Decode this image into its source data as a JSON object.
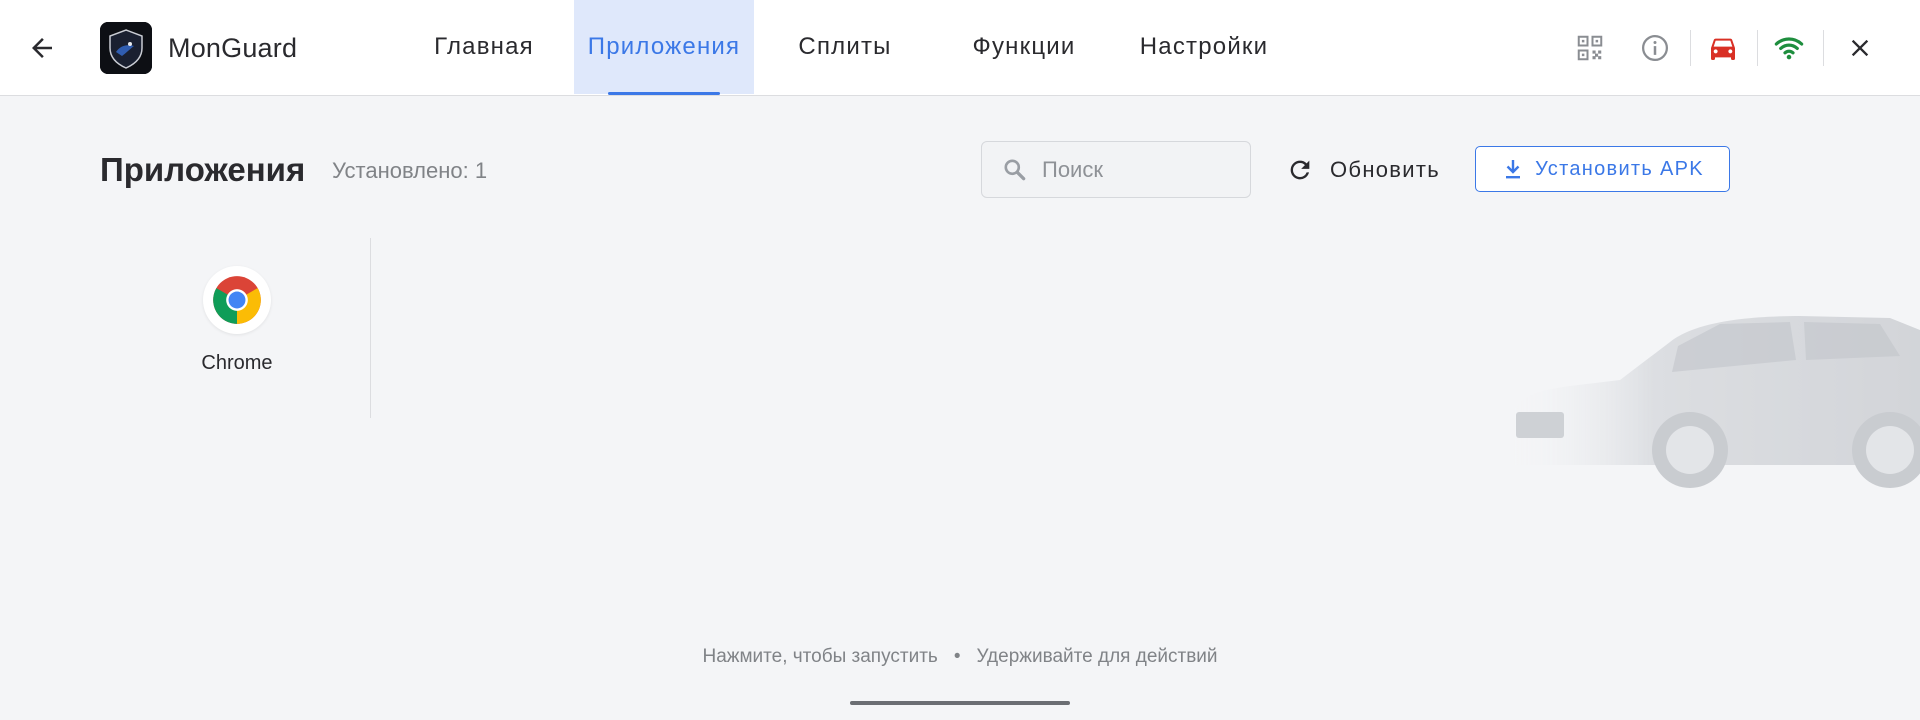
{
  "header": {
    "app_name": "MonGuard",
    "tabs": [
      {
        "label": "Главная",
        "active": false
      },
      {
        "label": "Приложения",
        "active": true
      },
      {
        "label": "Сплиты",
        "active": false
      },
      {
        "label": "Функции",
        "active": false
      },
      {
        "label": "Настройки",
        "active": false
      }
    ],
    "icons": [
      "back-arrow-icon",
      "qr-code-icon",
      "info-icon",
      "car-icon",
      "wifi-icon",
      "close-icon"
    ]
  },
  "main": {
    "title": "Приложения",
    "installed_count": "Установлено: 1",
    "search_placeholder": "Поиск",
    "refresh_label": "Обновить",
    "install_label": "Установить APK",
    "apps": [
      {
        "label": "Chrome",
        "icon": "chrome-icon"
      }
    ]
  },
  "footer": {
    "hint_tap": "Нажмите, чтобы запустить",
    "hint_sep": "•",
    "hint_hold": "Удерживайте для действий"
  },
  "colors": {
    "accent": "#3b78e7",
    "tab_active_bg": "#dfe8fb",
    "car_status": "#d93025",
    "wifi_status": "#1e8e3e"
  }
}
